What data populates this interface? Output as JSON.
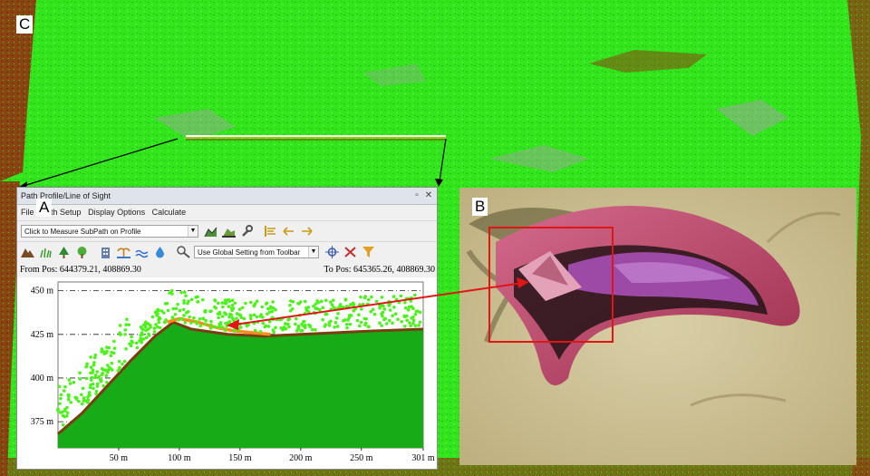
{
  "panels": {
    "a_label": "A",
    "b_label": "B",
    "c_label": "C"
  },
  "window": {
    "title": "Path Profile/Line of Sight",
    "menu": [
      "File",
      "Path Setup",
      "Display Options",
      "Calculate"
    ],
    "subpath_combo": "Click to Measure SubPath on Profile",
    "setting_combo": "Use Global Setting from Toolbar",
    "from_pos": "From Pos: 644379.21, 408869.30",
    "to_pos": "To Pos: 645365.26, 408869.30"
  },
  "icons": {
    "toolbar1": [
      "profile-area-icon",
      "profile-fill-icon",
      "wrench-icon",
      "align-left-icon",
      "swap-left-icon",
      "swap-right-icon"
    ],
    "toolbar2": [
      "mountain-icon",
      "grass-icon",
      "tree-icon",
      "deciduous-tree-icon",
      "building-icon",
      "palm-icon",
      "water-icon",
      "water-drop-icon",
      "measure-icon",
      "crosshair-icon",
      "scissors-icon",
      "filter-icon"
    ]
  },
  "colors": {
    "terrain": "#18ab18",
    "vegetation": "#4cf31b",
    "ground_band": "#7a3d0e",
    "subpath": "#ff8c1a",
    "link_arrow": "#e01616",
    "selection_box": "#e01616"
  },
  "chart_data": {
    "type": "area",
    "y_ticks": [
      "450 m",
      "425 m",
      "400 m",
      "375 m"
    ],
    "x_ticks": [
      "50 m",
      "100 m",
      "150 m",
      "200 m",
      "250 m",
      "301 m"
    ],
    "ylim": [
      360,
      455
    ],
    "xlim": [
      0,
      301
    ],
    "series": [
      {
        "x": [
          0,
          20,
          40,
          60,
          80,
          95,
          110,
          140,
          170,
          200,
          230,
          260,
          301
        ],
        "y": [
          368,
          380,
          395,
          410,
          424,
          432,
          428,
          425,
          424,
          425,
          426,
          427,
          428
        ]
      }
    ],
    "subpath": {
      "x": [
        90,
        100,
        115,
        130,
        145,
        160,
        175
      ],
      "y": [
        432,
        434,
        432,
        429,
        427,
        426,
        425
      ]
    }
  }
}
